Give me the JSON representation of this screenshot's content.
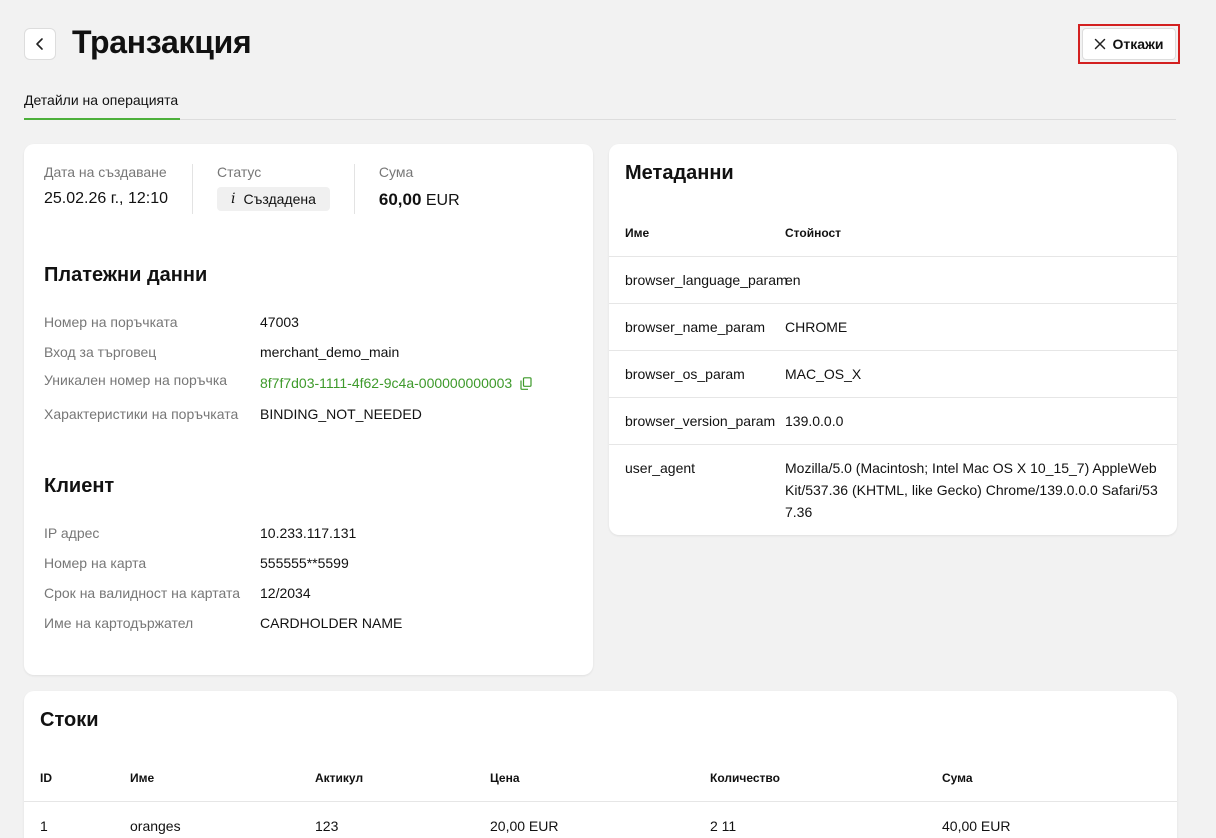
{
  "header": {
    "title": "Транзакция",
    "cancel_label": "Откажи"
  },
  "tabs": [
    {
      "label": "Детайли на операцията",
      "active": true
    }
  ],
  "summary": {
    "created_label": "Дата на създаване",
    "created_value": "25.02.26 г., 12:10",
    "status_label": "Статус",
    "status_value": "Създадена",
    "amount_label": "Сума",
    "amount_number": "60,00",
    "amount_currency": "EUR"
  },
  "payment": {
    "title": "Платежни данни",
    "rows": [
      {
        "label": "Номер на поръчката",
        "value": "47003"
      },
      {
        "label": "Вход за търговец",
        "value": "merchant_demo_main"
      },
      {
        "label": "Уникален номер на поръчка",
        "value": "8f7f7d03-1111-4f62-9c4a-000000000003"
      },
      {
        "label": "Характеристики на поръчката",
        "value": "BINDING_NOT_NEEDED"
      }
    ]
  },
  "client": {
    "title": "Клиент",
    "rows": [
      {
        "label": "IP адрес",
        "value": "10.233.117.131"
      },
      {
        "label": "Номер на карта",
        "value": "555555**5599"
      },
      {
        "label": "Срок на валидност на картата",
        "value": "12/2034"
      },
      {
        "label": "Име на картодържател",
        "value": "CARDHOLDER NAME"
      }
    ]
  },
  "metadata": {
    "title": "Метаданни",
    "col_name": "Име",
    "col_value": "Стойност",
    "rows": [
      {
        "name": "browser_language_param",
        "value": "en"
      },
      {
        "name": "browser_name_param",
        "value": "CHROME"
      },
      {
        "name": "browser_os_param",
        "value": "MAC_OS_X"
      },
      {
        "name": "browser_version_param",
        "value": "139.0.0.0"
      },
      {
        "name": "user_agent",
        "value": "Mozilla/5.0 (Macintosh; Intel Mac OS X 10_15_7) AppleWebKit/537.36 (KHTML, like Gecko) Chrome/139.0.0.0 Safari/537.36"
      }
    ]
  },
  "goods": {
    "title": "Стоки",
    "columns": [
      "ID",
      "Име",
      "Актикул",
      "Цена",
      "Количество",
      "Сума"
    ],
    "rows": [
      [
        "1",
        "oranges",
        "123",
        "20,00 EUR",
        "2 11",
        "40,00 EUR"
      ]
    ]
  },
  "colors": {
    "accent": "#4caf3a",
    "link": "#3e9a2b",
    "highlight": "#d32020"
  },
  "icons": {
    "back": "chevron-left-icon",
    "cancel": "close-icon",
    "status": "info-icon",
    "copy": "copy-icon"
  }
}
